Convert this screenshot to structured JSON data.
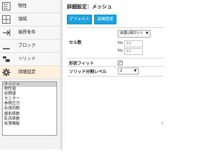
{
  "nav": [
    {
      "label": "物性",
      "icon": "material-icon"
    },
    {
      "label": "領域",
      "icon": "region-icon"
    },
    {
      "label": "境界条件",
      "icon": "boundary-condition-icon"
    },
    {
      "label": "ブロック",
      "icon": "block-icon"
    },
    {
      "label": "ソリッド",
      "icon": "solid-icon"
    },
    {
      "label": "詳細設定",
      "icon": "gear-icon",
      "active": true
    }
  ],
  "settings_list": {
    "selected": "メッシュ",
    "items": [
      "メッシュ",
      "物性値",
      "初期値",
      "モニター",
      "参照圧力",
      "反復回数",
      "緩和係数",
      "乱流係数",
      "拡張機能"
    ]
  },
  "detail": {
    "title": "詳細設定：メッシュ",
    "default_button": "デフォルト",
    "high_precision_button": "高精度度",
    "cell_count": {
      "label": "セル数",
      "mode": "自動(細かい)",
      "nx_label": "Nx",
      "nx_value": "50",
      "ny_label": "Ny",
      "ny_value": "50"
    },
    "shape_fit": {
      "label": "形状フィット",
      "checked": true,
      "mark": "✓"
    },
    "solid_level": {
      "label": "ソリッド分割レベル",
      "value": "2"
    }
  },
  "collapse_arrow": "‹",
  "colors": {
    "accent": "#1aa3e0",
    "active_nav": "#fdf0dc"
  }
}
